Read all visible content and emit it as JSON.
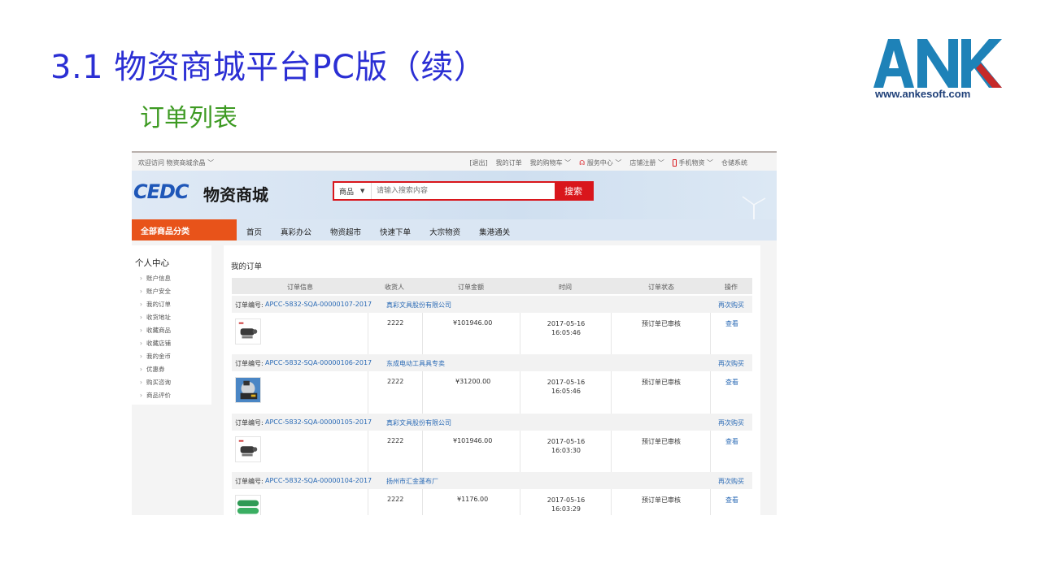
{
  "slide": {
    "title": "3.1 物资商城平台PC版（续）",
    "subtitle": "订单列表",
    "logo_text": "ANK",
    "logo_url": "www.ankesoft.com",
    "colors": {
      "title": "#2b2fd4",
      "subtitle": "#3d9a22",
      "logo_blue": "#1e82b8",
      "logo_red": "#c62a2a"
    }
  },
  "topbar": {
    "welcome": "欢迎访问 物资商城余晶 ﹀",
    "logout": "[退出]",
    "my_orders": "我的订单",
    "cart": "我的购物车 ﹀",
    "service": "服务中心 ﹀",
    "store_reg": "店铺注册 ﹀",
    "mobile": "手机物资 ﹀",
    "warehouse": "仓储系统"
  },
  "header": {
    "brand_mark": "CEDC",
    "mall_name": "物资商城",
    "search_category": "商品",
    "search_placeholder": "请输入搜索内容",
    "search_button": "搜索"
  },
  "nav": {
    "all_categories": "全部商品分类",
    "items": [
      "首页",
      "真彩办公",
      "物资超市",
      "快速下单",
      "大宗物资",
      "集港通关"
    ]
  },
  "sidebar": {
    "title": "个人中心",
    "items": [
      "账户信息",
      "账户安全",
      "我的订单",
      "收货地址",
      "收藏商品",
      "收藏店铺",
      "我的金币",
      "优惠券",
      "购买咨询",
      "商品评价"
    ]
  },
  "orders": {
    "title": "我的订单",
    "columns": [
      "订单信息",
      "收货人",
      "订单金额",
      "时间",
      "订单状态",
      "操作"
    ],
    "order_no_label": "订单编号:",
    "rebuy_label": "再次购买",
    "view_label": "查看",
    "list": [
      {
        "order_no": "APCC-5832-SQA-00000107-2017",
        "shop": "真彩文具股份有限公司",
        "receiver": "2222",
        "amount": "¥101946.00",
        "date": "2017-05-16",
        "time": "16:05:46",
        "status": "预订单已审核",
        "thumb": "level-instrument"
      },
      {
        "order_no": "APCC-5832-SQA-00000106-2017",
        "shop": "东成电动工具具专卖",
        "receiver": "2222",
        "amount": "¥31200.00",
        "date": "2017-05-16",
        "time": "16:05:46",
        "status": "预订单已审核",
        "thumb": "cutting-machine"
      },
      {
        "order_no": "APCC-5832-SQA-00000105-2017",
        "shop": "真彩文具股份有限公司",
        "receiver": "2222",
        "amount": "¥101946.00",
        "date": "2017-05-16",
        "time": "16:03:30",
        "status": "预订单已审核",
        "thumb": "level-instrument"
      },
      {
        "order_no": "APCC-5832-SQA-00000104-2017",
        "shop": "扬州市汇金蓬布厂",
        "receiver": "2222",
        "amount": "¥1176.00",
        "date": "2017-05-16",
        "time": "16:03:29",
        "status": "预订单已审核",
        "thumb": "green-tarp"
      }
    ]
  }
}
